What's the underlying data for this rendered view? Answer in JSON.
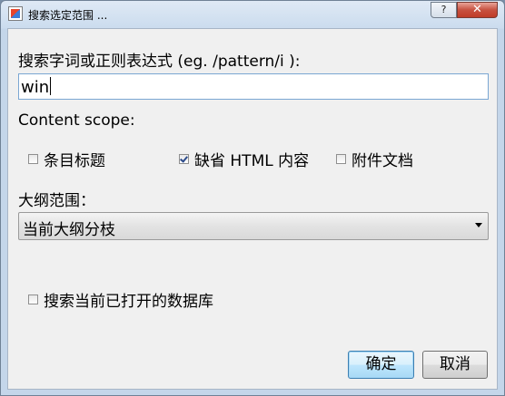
{
  "window": {
    "title": "搜索选定范围 ..."
  },
  "titlebar_buttons": {
    "help": "?",
    "close": "✕"
  },
  "search": {
    "label": "搜索字词或正则表达式 (eg. /pattern/i ):",
    "value": "win"
  },
  "content_scope": {
    "label": "Content scope:",
    "options": [
      {
        "label": "条目标题",
        "checked": false
      },
      {
        "label": "缺省 HTML 内容",
        "checked": true
      },
      {
        "label": "附件文档",
        "checked": false
      }
    ]
  },
  "outline_scope": {
    "label": "大纲范围：",
    "selected": "当前大纲分枝"
  },
  "search_open_db": {
    "label": "搜索当前已打开的数据库",
    "checked": false
  },
  "buttons": {
    "ok": "确定",
    "cancel": "取消"
  }
}
